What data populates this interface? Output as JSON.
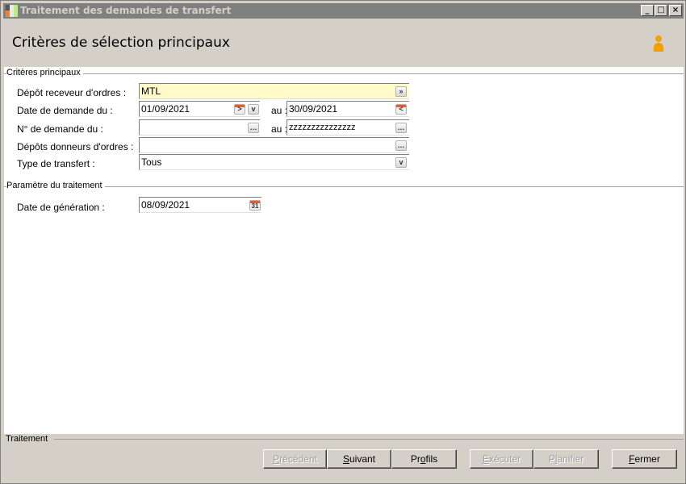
{
  "window": {
    "title": "Traitement des demandes de transfert",
    "min": "_",
    "max": "□",
    "close": "×"
  },
  "header": {
    "title": "Critères de sélection principaux",
    "icon": "user-icon"
  },
  "sections": {
    "main": "Critères principaux",
    "params": "Paramètre du traitement",
    "footer": "Traitement"
  },
  "fields": {
    "depot_label": "Dépôt receveur d'ordres :",
    "depot_value": "MTL",
    "date_label": "Date de demande du :",
    "date_from": "01/09/2021",
    "au1": "au :",
    "date_to": "30/09/2021",
    "num_label": "N° de demande du :",
    "num_from": "",
    "au2": "au :",
    "num_to": "zzzzzzzzzzzzzzz",
    "donneurs_label": "Dépôts donneurs d'ordres :",
    "donneurs_value": "",
    "type_label": "Type de transfert :",
    "type_value": "Tous",
    "gen_label": "Date de génération :",
    "gen_value": "08/09/2021",
    "cal_day": "31"
  },
  "buttons": [
    {
      "pre": "",
      "key": "P",
      "post": "récédent",
      "enabled": false
    },
    {
      "pre": "",
      "key": "S",
      "post": "uivant",
      "enabled": true
    },
    {
      "pre": "Pr",
      "key": "o",
      "post": "fils",
      "enabled": true
    },
    {
      "pre": "",
      "key": "E",
      "post": "xécuter",
      "enabled": false
    },
    {
      "pre": "P",
      "key": "l",
      "post": "anifier",
      "enabled": false
    },
    {
      "pre": "",
      "key": "F",
      "post": "ermer",
      "enabled": true
    }
  ],
  "colors": {
    "highlight_field": "#fffac8",
    "accent": "#e65a2d"
  }
}
